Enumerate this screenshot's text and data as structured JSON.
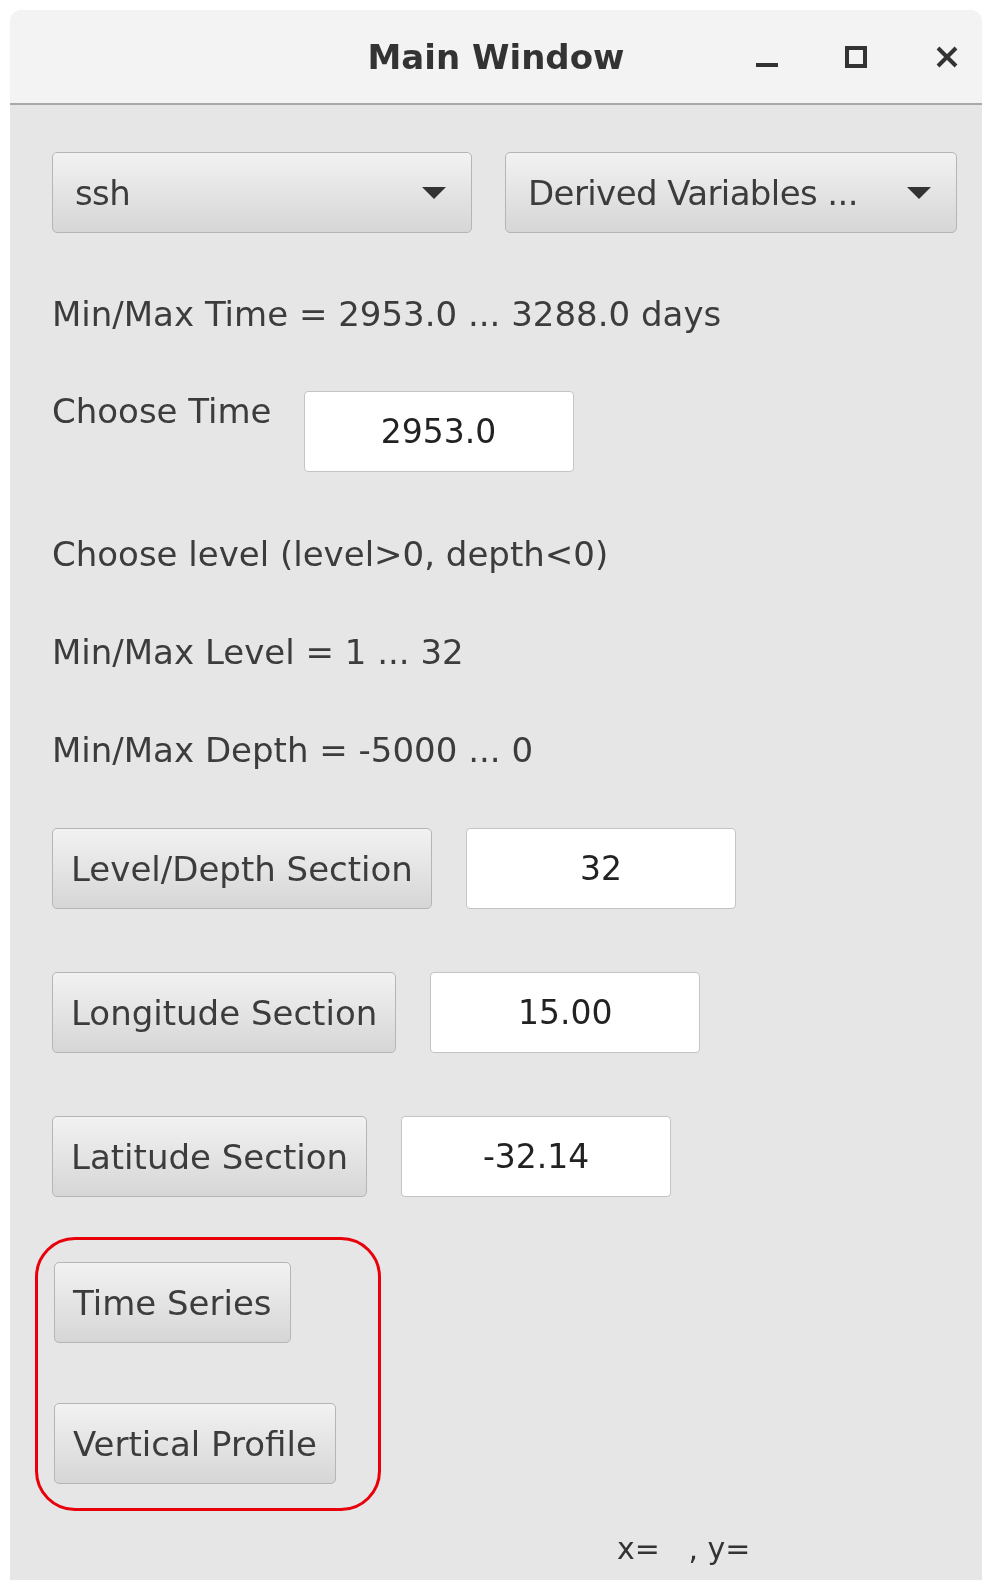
{
  "window": {
    "title": "Main Window"
  },
  "dropdowns": [
    {
      "value": "ssh"
    },
    {
      "value": "Derived Variables ..."
    }
  ],
  "time_range": "Min/Max Time = 2953.0 ... 3288.0 days",
  "choose_time": {
    "label": "Choose Time",
    "value": "2953.0"
  },
  "level_hint": "Choose level (level>0, depth<0)",
  "level_range": "Min/Max Level = 1 ... 32",
  "depth_range": "Min/Max Depth = -5000 ... 0",
  "sections": [
    {
      "button": "Level/Depth Section",
      "value": "32"
    },
    {
      "button": "Longitude Section",
      "value": "15.00"
    },
    {
      "button": "Latitude Section",
      "value": "-32.14"
    }
  ],
  "plot_buttons": {
    "highlighted": true,
    "buttons": [
      "Time Series",
      "Vertical Profile"
    ]
  },
  "coordinates": "x=   , y="
}
